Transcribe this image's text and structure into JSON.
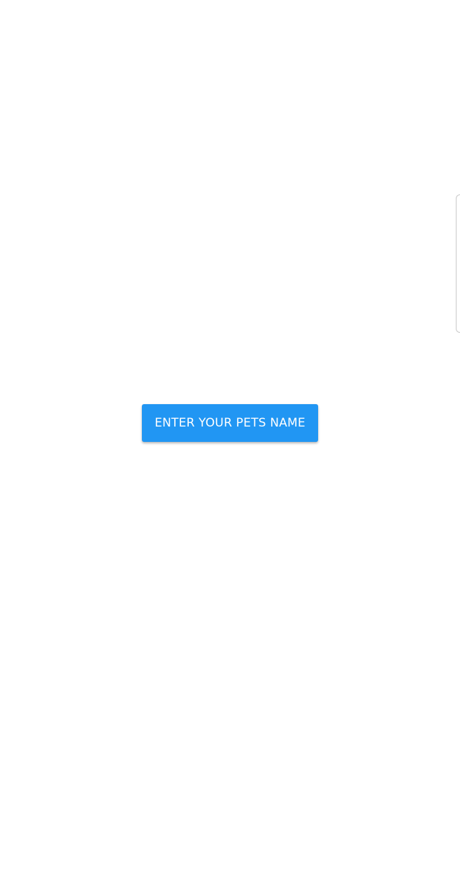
{
  "screen": {
    "background_color": "#ffffff"
  },
  "main": {
    "button": {
      "label": "ENTER YOUR PETS NAME",
      "color": "#2196F3",
      "text_color": "#ffffff"
    }
  },
  "edge_panel": {
    "icon": "edge-panel-handle"
  }
}
